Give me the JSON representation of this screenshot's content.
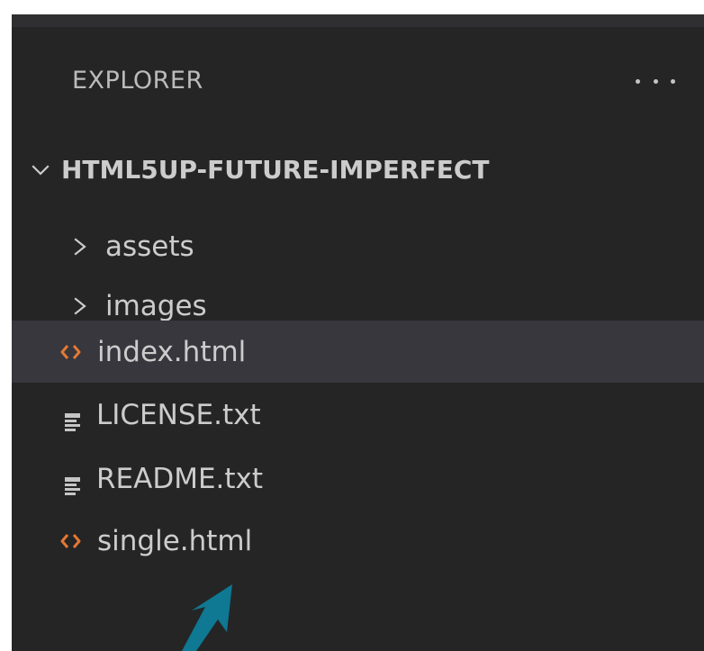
{
  "explorer": {
    "title": "EXPLORER",
    "menu_icon": "more-horizontal-icon",
    "root": {
      "label": "HTML5UP-FUTURE-IMPERFECT",
      "icon": "chevron-down-icon"
    },
    "items": [
      {
        "label": "assets",
        "type": "folder",
        "icon": "chevron-right-icon"
      },
      {
        "label": "images",
        "type": "folder",
        "icon": "chevron-right-icon"
      },
      {
        "label": "index.html",
        "type": "file",
        "icon": "html-file-icon",
        "selected": true
      },
      {
        "label": "LICENSE.txt",
        "type": "file",
        "icon": "text-file-icon"
      },
      {
        "label": "README.txt",
        "type": "file",
        "icon": "text-file-icon"
      },
      {
        "label": "single.html",
        "type": "file",
        "icon": "html-file-icon"
      }
    ]
  },
  "colors": {
    "panel_background": "#252526",
    "selected_row": "#37373d",
    "text": "#cccccc",
    "html_icon": "#e37933",
    "arrow_annotation": "#0f7892"
  }
}
